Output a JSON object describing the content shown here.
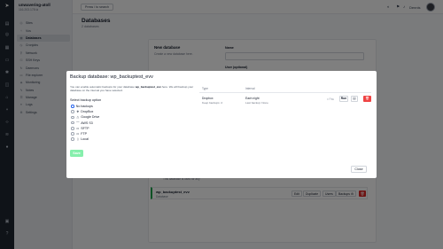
{
  "rail": {
    "icons": [
      "logo-icon",
      "server-icon",
      "sites-icon",
      "database-icon",
      "terminal-icon",
      "settings-icon",
      "files-icon",
      "dashboard-icon",
      "git-icon",
      "code-icon",
      "layers-icon",
      "user-icon",
      "docs-icon",
      "help-icon"
    ]
  },
  "server": {
    "name": "unwavering-atoll",
    "ip": "116.203.178"
  },
  "nav": [
    {
      "label": "Sites",
      "icon": "sites-icon"
    },
    {
      "label": "Vcs",
      "icon": "vcs-icon"
    },
    {
      "label": "Databases",
      "icon": "database-icon",
      "active": true
    },
    {
      "label": "Cronjobs",
      "icon": "cron-icon"
    },
    {
      "label": "Network",
      "icon": "network-icon"
    },
    {
      "label": "SSH Keys",
      "icon": "key-icon"
    },
    {
      "label": "Daemons",
      "icon": "daemon-icon"
    },
    {
      "label": "File explorer",
      "icon": "folder-icon"
    },
    {
      "label": "Monitoring",
      "icon": "monitor-icon"
    },
    {
      "label": "Notes",
      "icon": "notes-icon"
    },
    {
      "label": "Manage",
      "icon": "manage-icon"
    },
    {
      "label": "Logs",
      "icon": "logs-icon"
    },
    {
      "label": "Settings",
      "icon": "gear-icon"
    }
  ],
  "topbar": {
    "search_label": "Press / to search",
    "user_name": "Dennis"
  },
  "page": {
    "title": "Databases",
    "subtitle": "2 databases"
  },
  "new_db": {
    "title": "New database",
    "desc": "Create a new database here.",
    "name_label": "Name",
    "user_label": "User (optional)"
  },
  "db_row": {
    "name": "wp_backuptest_evv",
    "desc": "Database",
    "notice": "This database is used for any",
    "buttons": [
      "Edit",
      "Duplicate",
      "Users",
      "Backups"
    ]
  },
  "modal": {
    "title": "Backup database: wp_backuptest_evv",
    "desc_pre": "You can enable automatic backups for your database",
    "desc_db": "wp_backuptest_evv",
    "desc_post": "here. We will backup your database on the interval you have selected.",
    "select_label": "Select backup option",
    "options": [
      {
        "label": "No backups",
        "icon": "",
        "selected": true
      },
      {
        "label": "DropBox",
        "icon": "dropbox-icon"
      },
      {
        "label": "Google Drive",
        "icon": "google-drive-icon"
      },
      {
        "label": "AWS S3",
        "icon": "aws-icon"
      },
      {
        "label": "SFTP",
        "icon": "sftp-icon"
      },
      {
        "label": "FTP",
        "icon": "ftp-icon"
      },
      {
        "label": "Local",
        "icon": "local-icon"
      }
    ],
    "save_label": "Save",
    "close_label": "Close",
    "table": {
      "headers": [
        "Type",
        "Interval"
      ],
      "row": {
        "type": "Dropbox",
        "keep": "Keep backups: 2",
        "interval": "Each night",
        "last_backup": "Last backup: None",
        "pause_label": "Pau",
        "run_label": "Run"
      }
    }
  },
  "colors": {
    "accent": "#2563eb",
    "success": "#16a34a",
    "danger": "#ef4444",
    "sidebar": "#1e2630"
  }
}
